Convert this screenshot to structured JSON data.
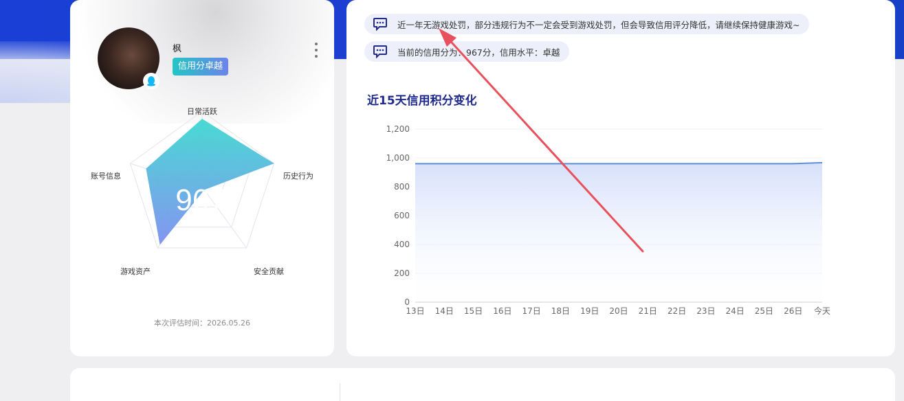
{
  "profile": {
    "username": "枫",
    "credit_tag": "信用分卓越",
    "score": "967",
    "eval_time": "本次评估时间：2026.05.26"
  },
  "radar": {
    "axes": [
      "日常活跃",
      "历史行为",
      "安全贡献",
      "游戏资产",
      "账号信息"
    ],
    "values": [
      0.9,
      1.0,
      0.05,
      0.95,
      0.78
    ]
  },
  "notices": {
    "n1": "近一年无游戏处罚，部分违规行为不一定会受到游戏处罚，但会导致信用评分降低，请继续保持健康游戏~",
    "n2": "当前的信用分为：967分，信用水平：卓越"
  },
  "chart_title": "近15天信用积分变化",
  "chart_data": {
    "type": "area",
    "title": "近15天信用积分变化",
    "categories": [
      "13日",
      "14日",
      "15日",
      "16日",
      "17日",
      "18日",
      "19日",
      "20日",
      "21日",
      "22日",
      "23日",
      "24日",
      "25日",
      "26日",
      "今天"
    ],
    "series": [
      {
        "values": [
          960,
          960,
          960,
          960,
          960,
          960,
          960,
          960,
          960,
          960,
          960,
          960,
          960,
          960,
          967
        ]
      }
    ],
    "yticks": [
      "0",
      "200",
      "400",
      "600",
      "800",
      "1,000",
      "1,200"
    ],
    "ylim": [
      0,
      1200
    ],
    "xlabel": "",
    "ylabel": "",
    "grid": true
  },
  "colors": {
    "accent": "#1f2a8c",
    "line": "#5b8fd9",
    "arrow": "#e8505b",
    "radar_a": "#3fd8d0",
    "radar_b": "#7e8ff0"
  }
}
